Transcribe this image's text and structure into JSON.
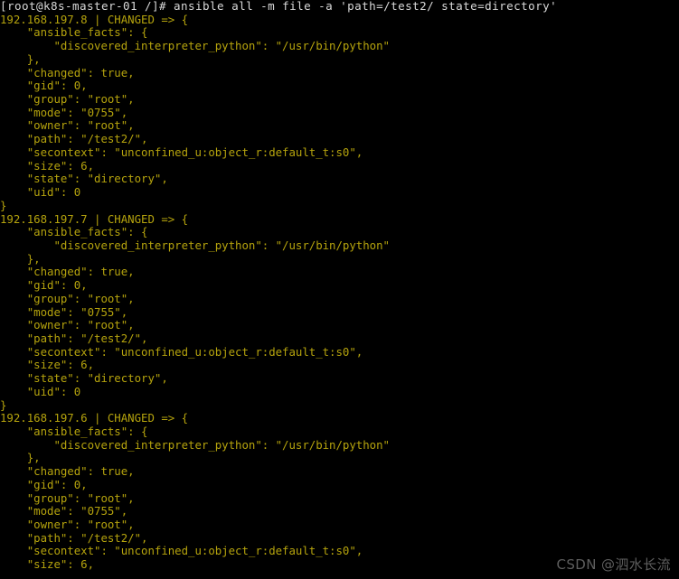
{
  "window": {
    "title": "Terminal",
    "background_color": "#000000",
    "foreground_color": "#b5a30d",
    "prompt_color": "#d8d8d8",
    "watermark_color": "#5e5e5e"
  },
  "terminal": {
    "prompt": {
      "user_host_path": "[root@k8s-master-01 /]#",
      "command": "ansible all -m file -a 'path=/test2/ state=directory'",
      "full_line": "[root@k8s-master-01 /]# ansible all -m file -a 'path=/test2/ state=directory'"
    },
    "lines": [
      {
        "id": "l0",
        "kind": "prompt",
        "text": "[root@k8s-master-01 /]# ansible all -m file -a 'path=/test2/ state=directory'"
      },
      {
        "id": "l1",
        "kind": "host",
        "text": "192.168.197.8 | CHANGED => {"
      },
      {
        "id": "l2",
        "kind": "body",
        "text": "    \"ansible_facts\": {"
      },
      {
        "id": "l3",
        "kind": "body",
        "text": "        \"discovered_interpreter_python\": \"/usr/bin/python\""
      },
      {
        "id": "l4",
        "kind": "body",
        "text": "    },"
      },
      {
        "id": "l5",
        "kind": "body",
        "text": "    \"changed\": true,"
      },
      {
        "id": "l6",
        "kind": "body",
        "text": "    \"gid\": 0,"
      },
      {
        "id": "l7",
        "kind": "body",
        "text": "    \"group\": \"root\","
      },
      {
        "id": "l8",
        "kind": "body",
        "text": "    \"mode\": \"0755\","
      },
      {
        "id": "l9",
        "kind": "body",
        "text": "    \"owner\": \"root\","
      },
      {
        "id": "l10",
        "kind": "body",
        "text": "    \"path\": \"/test2/\","
      },
      {
        "id": "l11",
        "kind": "body",
        "text": "    \"secontext\": \"unconfined_u:object_r:default_t:s0\","
      },
      {
        "id": "l12",
        "kind": "body",
        "text": "    \"size\": 6,"
      },
      {
        "id": "l13",
        "kind": "body",
        "text": "    \"state\": \"directory\","
      },
      {
        "id": "l14",
        "kind": "body",
        "text": "    \"uid\": 0"
      },
      {
        "id": "l15",
        "kind": "body",
        "text": "}"
      },
      {
        "id": "l16",
        "kind": "host",
        "text": "192.168.197.7 | CHANGED => {"
      },
      {
        "id": "l17",
        "kind": "body",
        "text": "    \"ansible_facts\": {"
      },
      {
        "id": "l18",
        "kind": "body",
        "text": "        \"discovered_interpreter_python\": \"/usr/bin/python\""
      },
      {
        "id": "l19",
        "kind": "body",
        "text": "    },"
      },
      {
        "id": "l20",
        "kind": "body",
        "text": "    \"changed\": true,"
      },
      {
        "id": "l21",
        "kind": "body",
        "text": "    \"gid\": 0,"
      },
      {
        "id": "l22",
        "kind": "body",
        "text": "    \"group\": \"root\","
      },
      {
        "id": "l23",
        "kind": "body",
        "text": "    \"mode\": \"0755\","
      },
      {
        "id": "l24",
        "kind": "body",
        "text": "    \"owner\": \"root\","
      },
      {
        "id": "l25",
        "kind": "body",
        "text": "    \"path\": \"/test2/\","
      },
      {
        "id": "l26",
        "kind": "body",
        "text": "    \"secontext\": \"unconfined_u:object_r:default_t:s0\","
      },
      {
        "id": "l27",
        "kind": "body",
        "text": "    \"size\": 6,"
      },
      {
        "id": "l28",
        "kind": "body",
        "text": "    \"state\": \"directory\","
      },
      {
        "id": "l29",
        "kind": "body",
        "text": "    \"uid\": 0"
      },
      {
        "id": "l30",
        "kind": "body",
        "text": "}"
      },
      {
        "id": "l31",
        "kind": "host",
        "text": "192.168.197.6 | CHANGED => {"
      },
      {
        "id": "l32",
        "kind": "body",
        "text": "    \"ansible_facts\": {"
      },
      {
        "id": "l33",
        "kind": "body",
        "text": "        \"discovered_interpreter_python\": \"/usr/bin/python\""
      },
      {
        "id": "l34",
        "kind": "body",
        "text": "    },"
      },
      {
        "id": "l35",
        "kind": "body",
        "text": "    \"changed\": true,"
      },
      {
        "id": "l36",
        "kind": "body",
        "text": "    \"gid\": 0,"
      },
      {
        "id": "l37",
        "kind": "body",
        "text": "    \"group\": \"root\","
      },
      {
        "id": "l38",
        "kind": "body",
        "text": "    \"mode\": \"0755\","
      },
      {
        "id": "l39",
        "kind": "body",
        "text": "    \"owner\": \"root\","
      },
      {
        "id": "l40",
        "kind": "body",
        "text": "    \"path\": \"/test2/\","
      },
      {
        "id": "l41",
        "kind": "body",
        "text": "    \"secontext\": \"unconfined_u:object_r:default_t:s0\","
      },
      {
        "id": "l42",
        "kind": "body",
        "text": "    \"size\": 6,"
      }
    ],
    "hosts": [
      {
        "address": "192.168.197.8",
        "status": "CHANGED",
        "result": {
          "ansible_facts": {
            "discovered_interpreter_python": "/usr/bin/python"
          },
          "changed": "true",
          "gid": "0",
          "group": "root",
          "mode": "0755",
          "owner": "root",
          "path": "/test2/",
          "secontext": "unconfined_u:object_r:default_t:s0",
          "size": "6",
          "state": "directory",
          "uid": "0"
        }
      },
      {
        "address": "192.168.197.7",
        "status": "CHANGED",
        "result": {
          "ansible_facts": {
            "discovered_interpreter_python": "/usr/bin/python"
          },
          "changed": "true",
          "gid": "0",
          "group": "root",
          "mode": "0755",
          "owner": "root",
          "path": "/test2/",
          "secontext": "unconfined_u:object_r:default_t:s0",
          "size": "6",
          "state": "directory",
          "uid": "0"
        }
      },
      {
        "address": "192.168.197.6",
        "status": "CHANGED",
        "result": {
          "ansible_facts": {
            "discovered_interpreter_python": "/usr/bin/python"
          },
          "changed": "true",
          "gid": "0",
          "group": "root",
          "mode": "0755",
          "owner": "root",
          "path": "/test2/",
          "secontext": "unconfined_u:object_r:default_t:s0",
          "size": "6"
        }
      }
    ]
  },
  "watermark": {
    "text": "CSDN @泗水长流"
  }
}
